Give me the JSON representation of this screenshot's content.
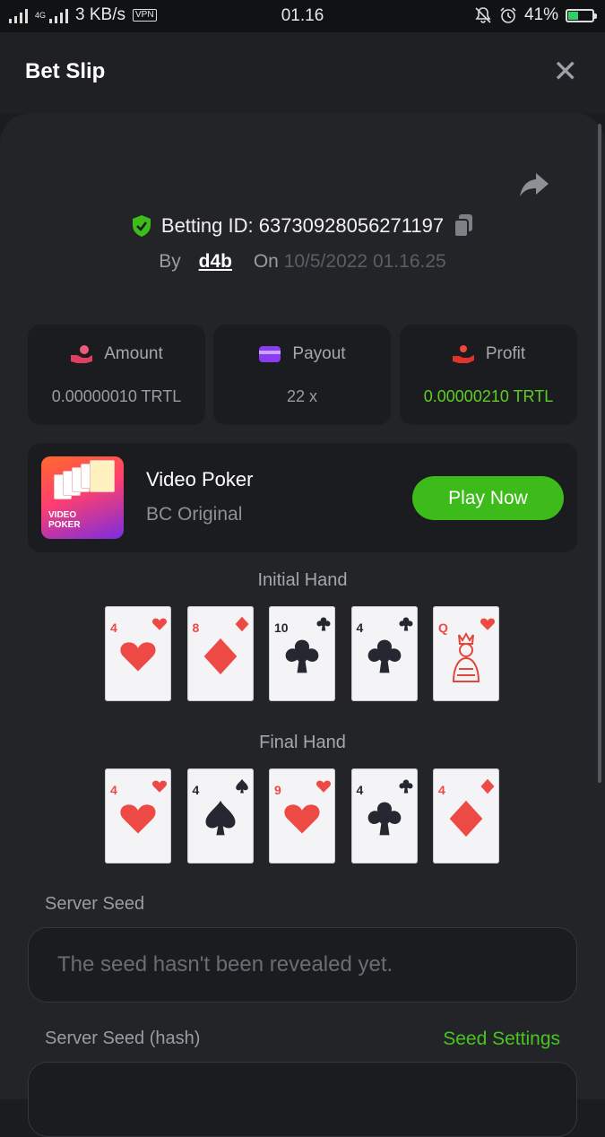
{
  "status_bar": {
    "network": "4G",
    "speed": "3 KB/s",
    "vpn": "VPN",
    "time": "01.16",
    "battery": "41%",
    "battery_level": 0.41
  },
  "header": {
    "title": "Bet Slip"
  },
  "bet": {
    "id_label": "Betting ID: 63730928056271197",
    "by_label": "By",
    "user": "d4b",
    "on_label": "On",
    "date": "10/5/2022 01.16.25"
  },
  "stats": {
    "amount_label": "Amount",
    "amount_value": "0.00000010 TRTL",
    "payout_label": "Payout",
    "payout_value": "22 x",
    "profit_label": "Profit",
    "profit_value": "0.00000210 TRTL"
  },
  "game": {
    "thumb_text_1": "VIDEO",
    "thumb_text_2": "POKER",
    "name": "Video Poker",
    "provider": "BC Original",
    "play_label": "Play Now"
  },
  "initial_hand": {
    "label": "Initial Hand",
    "cards": [
      {
        "rank": "4",
        "suit": "heart"
      },
      {
        "rank": "8",
        "suit": "diamond"
      },
      {
        "rank": "10",
        "suit": "club"
      },
      {
        "rank": "4",
        "suit": "club"
      },
      {
        "rank": "Q",
        "suit": "heart"
      }
    ]
  },
  "final_hand": {
    "label": "Final Hand",
    "cards": [
      {
        "rank": "4",
        "suit": "heart"
      },
      {
        "rank": "4",
        "suit": "spade"
      },
      {
        "rank": "9",
        "suit": "heart"
      },
      {
        "rank": "4",
        "suit": "club"
      },
      {
        "rank": "4",
        "suit": "diamond"
      }
    ]
  },
  "server_seed": {
    "label": "Server Seed",
    "placeholder": "The seed hasn't been revealed yet."
  },
  "server_seed_hash": {
    "label": "Server Seed (hash)",
    "settings_label": "Seed Settings"
  },
  "colors": {
    "green": "#3dbb1a",
    "red_suit": "#ee4a45",
    "black_suit": "#252830"
  }
}
